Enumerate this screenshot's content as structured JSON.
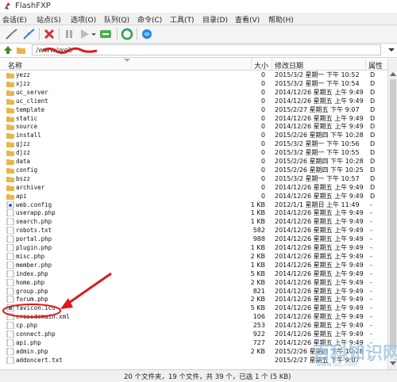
{
  "window": {
    "title": "FlashFXP"
  },
  "menu": [
    "会话(E)",
    "站点(S)",
    "选项(O)",
    "队列(Q)",
    "命令(C)",
    "工具(T)",
    "目录(D)",
    "查看(V)",
    "帮助(H)"
  ],
  "path": {
    "value": "/www/web"
  },
  "columns": {
    "name": "名称",
    "size": "大小",
    "date": "修改日期",
    "attr": "属性"
  },
  "files": [
    {
      "name": "yezz",
      "size": "0",
      "date": "2015/3/2 星期一 下午 10:52",
      "attr": "D",
      "type": "folder"
    },
    {
      "name": "xjzz",
      "size": "0",
      "date": "2015/3/2 星期一 下午 10:54",
      "attr": "D",
      "type": "folder"
    },
    {
      "name": "uc_server",
      "size": "0",
      "date": "2014/12/26 星期五 上午 9:49",
      "attr": "D",
      "type": "folder"
    },
    {
      "name": "uc_client",
      "size": "0",
      "date": "2014/12/26 星期五 上午 9:49",
      "attr": "D",
      "type": "folder"
    },
    {
      "name": "template",
      "size": "0",
      "date": "2015/2/27 星期五 下午 9:07",
      "attr": "D",
      "type": "folder"
    },
    {
      "name": "static",
      "size": "0",
      "date": "2014/12/26 星期五 上午 9:49",
      "attr": "D",
      "type": "folder"
    },
    {
      "name": "source",
      "size": "0",
      "date": "2014/12/26 星期五 上午 9:49",
      "attr": "D",
      "type": "folder"
    },
    {
      "name": "install",
      "size": "0",
      "date": "2015/2/26 星期四 下午 10:28",
      "attr": "D",
      "type": "folder"
    },
    {
      "name": "gjzz",
      "size": "0",
      "date": "2015/3/2 星期一 下午 10:56",
      "attr": "D",
      "type": "folder"
    },
    {
      "name": "djzz",
      "size": "0",
      "date": "2015/3/2 星期一 下午 10:55",
      "attr": "D",
      "type": "folder"
    },
    {
      "name": "data",
      "size": "0",
      "date": "2015/2/26 星期四 下午 10:28",
      "attr": "D",
      "type": "folder"
    },
    {
      "name": "config",
      "size": "0",
      "date": "2015/2/26 星期四 下午 10:25",
      "attr": "D",
      "type": "folder"
    },
    {
      "name": "bszz",
      "size": "0",
      "date": "2015/3/2 星期一 下午 10:57",
      "attr": "D",
      "type": "folder"
    },
    {
      "name": "archiver",
      "size": "0",
      "date": "2014/12/26 星期五 上午 9:49",
      "attr": "D",
      "type": "folder"
    },
    {
      "name": "api",
      "size": "0",
      "date": "2014/12/26 星期五 上午 9:49",
      "attr": "D",
      "type": "folder"
    },
    {
      "name": "web.config",
      "size": "1 KB",
      "date": "2012/1/1 星期日 上午 11:49",
      "attr": "-",
      "type": "config"
    },
    {
      "name": "userapp.php",
      "size": "1 KB",
      "date": "2014/12/26 星期五 上午 9:49",
      "attr": "-",
      "type": "file"
    },
    {
      "name": "search.php",
      "size": "1 KB",
      "date": "2014/12/26 星期五 上午 9:49",
      "attr": "-",
      "type": "file"
    },
    {
      "name": "robots.txt",
      "size": "582",
      "date": "2014/12/26 星期五 上午 9:49",
      "attr": "-",
      "type": "file"
    },
    {
      "name": "portal.php",
      "size": "988",
      "date": "2014/12/26 星期五 上午 9:49",
      "attr": "-",
      "type": "file"
    },
    {
      "name": "plugin.php",
      "size": "1 KB",
      "date": "2014/12/26 星期五 上午 9:49",
      "attr": "-",
      "type": "file"
    },
    {
      "name": "misc.php",
      "size": "2 KB",
      "date": "2014/12/26 星期五 上午 9:49",
      "attr": "-",
      "type": "file"
    },
    {
      "name": "member.php",
      "size": "1 KB",
      "date": "2014/12/26 星期五 上午 9:49",
      "attr": "-",
      "type": "file"
    },
    {
      "name": "index.php",
      "size": "5 KB",
      "date": "2014/12/26 星期五 上午 9:49",
      "attr": "-",
      "type": "file"
    },
    {
      "name": "home.php",
      "size": "2 KB",
      "date": "2014/12/26 星期五 上午 9:49",
      "attr": "-",
      "type": "file"
    },
    {
      "name": "group.php",
      "size": "821",
      "date": "2014/12/26 星期五 上午 9:49",
      "attr": "-",
      "type": "file"
    },
    {
      "name": "forum.php",
      "size": "2 KB",
      "date": "2014/12/26 星期五 上午 9:49",
      "attr": "-",
      "type": "file"
    },
    {
      "name": "favicon.ico",
      "size": "5 KB",
      "date": "2014/12/26 星期五 上午 9:49",
      "attr": "-",
      "type": "ico",
      "highlighted": true
    },
    {
      "name": "crossdomain.xml",
      "size": "106",
      "date": "2014/12/26 星期五 上午 9:49",
      "attr": "-",
      "type": "file"
    },
    {
      "name": "cp.php",
      "size": "253",
      "date": "2014/12/26 星期五 上午 9:49",
      "attr": "-",
      "type": "file"
    },
    {
      "name": "connect.php",
      "size": "922",
      "date": "2014/12/26 星期五 上午 9:49",
      "attr": "-",
      "type": "file"
    },
    {
      "name": "api.php",
      "size": "727",
      "date": "2014/12/26 星期五 上午 9:49",
      "attr": "-",
      "type": "file"
    },
    {
      "name": "admin.php",
      "size": "2 KB",
      "date": "2015/2/26 星期四 下午 10:28",
      "attr": "-",
      "type": "file"
    },
    {
      "name": "addoncert.txt",
      "size": "",
      "date": "2015/2/27 星期五 下午 9:07",
      "attr": "-",
      "type": "file"
    }
  ],
  "status": {
    "text": "20 个文件夹，19 个文件，共 39 个，已选 1 个 (5 KB)"
  },
  "watermark": {
    "line1": "百科知识网",
    "line2": "www.5zj.com"
  },
  "colors": {
    "annotation": "#e0191b",
    "folder": "#e8b64a",
    "watermark": "#9ec7e6"
  }
}
